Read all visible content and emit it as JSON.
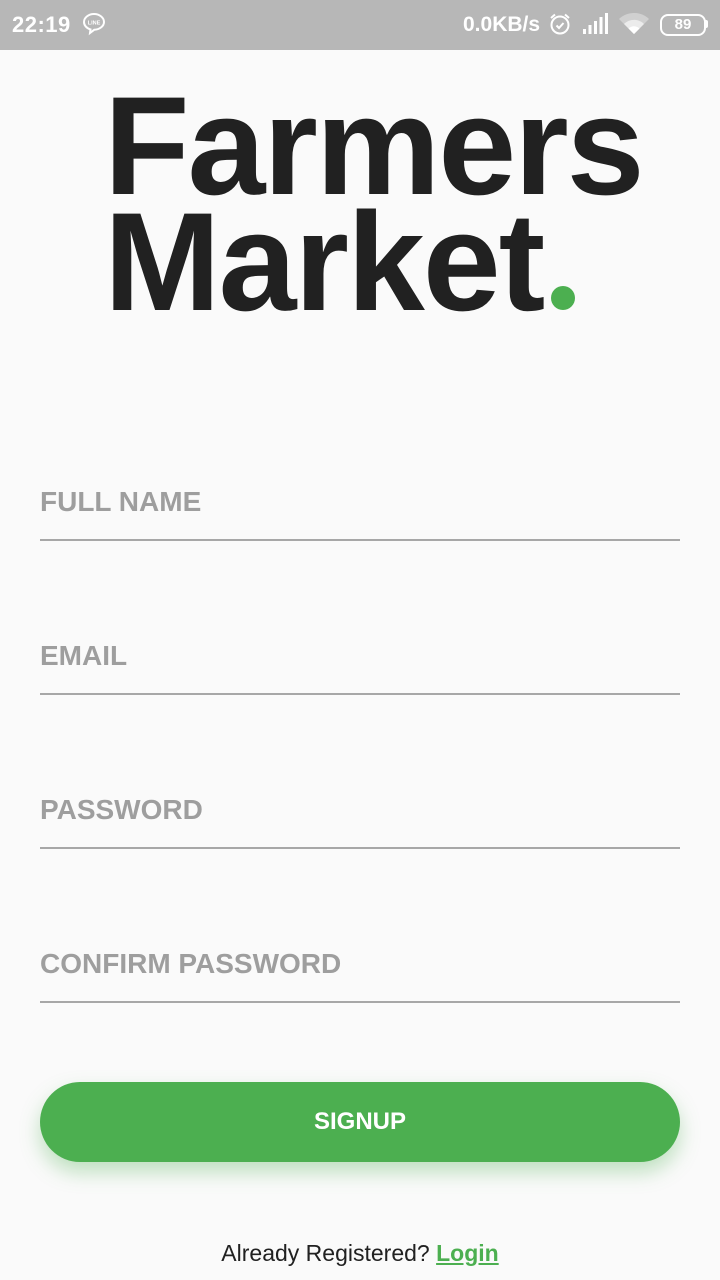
{
  "status_bar": {
    "time": "22:19",
    "network_speed": "0.0KB/s",
    "battery_level": "89",
    "icons": [
      "line-app-icon",
      "alarm-icon",
      "signal-icon",
      "wifi-icon",
      "battery-icon"
    ]
  },
  "logo": {
    "line1": "Farmers",
    "line2": "Market",
    "accent_color": "#4caf50"
  },
  "form": {
    "full_name_placeholder": "FULL NAME",
    "email_placeholder": "EMAIL",
    "password_placeholder": "PASSWORD",
    "confirm_password_placeholder": "CONFIRM PASSWORD"
  },
  "signup_button": {
    "label": "SIGNUP",
    "color": "#4caf50"
  },
  "footer": {
    "prompt": "Already Registered?",
    "login_link": "Login"
  }
}
